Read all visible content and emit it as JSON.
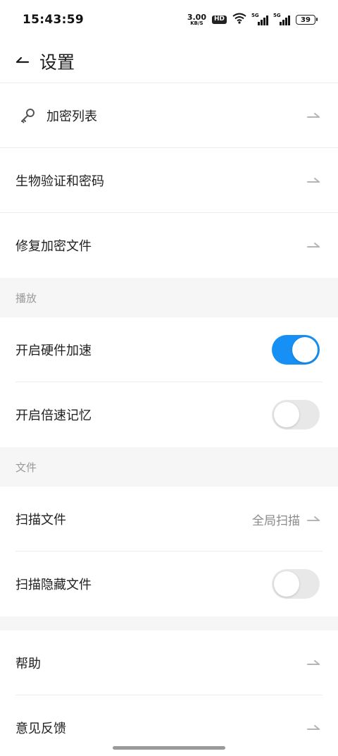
{
  "status_bar": {
    "time": "15:43:59",
    "net_speed_value": "3.00",
    "net_speed_unit": "KB/S",
    "hd_label": "HD",
    "sim1_label": "5G",
    "sim2_label": "5G",
    "battery_level": "39"
  },
  "header": {
    "title": "设置"
  },
  "rows": {
    "encrypted_list": {
      "label": "加密列表",
      "icon": "key-icon"
    },
    "biometric": {
      "label": "生物验证和密码"
    },
    "repair": {
      "label": "修复加密文件"
    }
  },
  "sections": {
    "playback": {
      "title": "播放",
      "hw_accel": {
        "label": "开启硬件加速",
        "enabled": true
      },
      "speed_memory": {
        "label": "开启倍速记忆",
        "enabled": false
      }
    },
    "files": {
      "title": "文件",
      "scan_files": {
        "label": "扫描文件",
        "value": "全局扫描"
      },
      "scan_hidden": {
        "label": "扫描隐藏文件",
        "enabled": false
      }
    }
  },
  "misc": {
    "help": {
      "label": "帮助"
    },
    "feedback": {
      "label": "意见反馈"
    }
  },
  "colors": {
    "accent": "#1690f5",
    "section_bg": "#f6f6f6",
    "secondary_text": "#9a9a9a"
  }
}
